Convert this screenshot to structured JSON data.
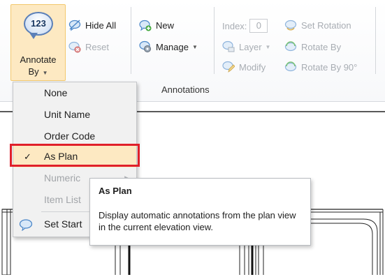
{
  "ribbon": {
    "annotate_by": {
      "badge": "123",
      "label_line1": "Annotate",
      "label_line2": "By"
    },
    "hide_all": "Hide All",
    "reset": "Reset",
    "new": "New",
    "manage": "Manage",
    "index_label": "Index:",
    "index_value": "0",
    "layer": "Layer",
    "modify": "Modify",
    "set_rotation": "Set Rotation",
    "rotate_by": "Rotate By",
    "rotate_by_90": "Rotate By 90°",
    "group_label": "Annotations"
  },
  "menu": {
    "items": [
      {
        "label": "None",
        "enabled": true
      },
      {
        "label": "Unit Name",
        "enabled": true
      },
      {
        "label": "Order Code",
        "enabled": true
      },
      {
        "label": "As Plan",
        "enabled": true,
        "checked": true,
        "selected": true
      },
      {
        "label": "Numeric",
        "enabled": false
      },
      {
        "label": "Item List",
        "enabled": false
      },
      {
        "label": "Set Start",
        "enabled": true
      }
    ]
  },
  "tooltip": {
    "title": "As Plan",
    "body": "Display automatic annotations from the plan view in the current elevation view."
  },
  "colors": {
    "highlight": "#fde9c2",
    "red_box": "#e0202a",
    "icon_blue": "#4a86c8",
    "icon_green": "#3fa63a"
  }
}
